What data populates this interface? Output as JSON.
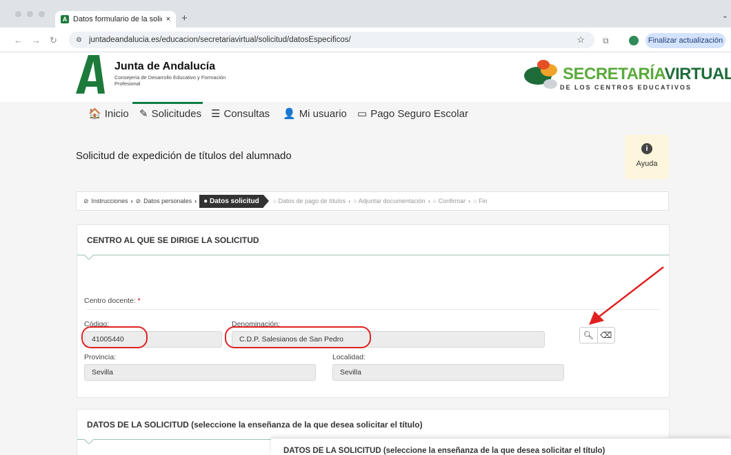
{
  "browser": {
    "tab_title": "Datos formulario de la solicit",
    "tab_close": "×",
    "new_tab": "+",
    "url": "juntadeandalucia.es/educacion/secretariavirtual/solicitud/datosEspecificos/",
    "update_button": "Finalizar actualización",
    "chevron": "⌄"
  },
  "header": {
    "brand_name": "Junta de Andalucía",
    "brand_sub": "Consejería de Desarrollo Educativo y Formación Profesional",
    "sv_title_a": "SECRETARÍA",
    "sv_title_b": "VIRTUAL",
    "sv_sub": "DE LOS CENTROS EDUCATIVOS"
  },
  "nav": {
    "items": [
      {
        "icon": "🏠",
        "label": "Inicio"
      },
      {
        "icon": "✎",
        "label": "Solicitudes"
      },
      {
        "icon": "☰",
        "label": "Consultas"
      },
      {
        "icon": "👤",
        "label": "Mi usuario"
      },
      {
        "icon": "▭",
        "label": "Pago Seguro Escolar"
      }
    ],
    "active": "Solicitudes"
  },
  "page": {
    "title": "Solicitud de expedición de títulos del alumnado",
    "help_icon": "i",
    "help_label": "Ayuda"
  },
  "steps": [
    {
      "label": "Instrucciones",
      "state": "done"
    },
    {
      "label": "Datos personales",
      "state": "done"
    },
    {
      "label": "Datos solicitud",
      "state": "current"
    },
    {
      "label": "Datos de pago de títulos",
      "state": "todo"
    },
    {
      "label": "Adjuntar documentación",
      "state": "todo"
    },
    {
      "label": "Confirmar",
      "state": "todo"
    },
    {
      "label": "Fin",
      "state": "todo"
    }
  ],
  "centro": {
    "heading": "CENTRO AL QUE SE DIRIGE LA SOLICITUD",
    "centro_label": "Centro docente:",
    "required_mark": "*",
    "codigo_label": "Código:",
    "codigo_value": "41005440",
    "denominacion_label": "Denominación:",
    "denominacion_value": "C.D.P. Salesianos de San Pedro",
    "provincia_label": "Provincia:",
    "provincia_value": "Sevilla",
    "localidad_label": "Localidad:",
    "localidad_value": "Sevilla"
  },
  "datos": {
    "heading": "DATOS DE LA SOLICITUD (seleccione la enseñanza de la que desea solicitar el título)",
    "popup_heading": "DATOS DE LA SOLICITUD (seleccione la enseñanza de la que desea solicitar el título)"
  },
  "colors": {
    "accent_green": "#0a7d45",
    "annotation_red": "#e02020"
  }
}
